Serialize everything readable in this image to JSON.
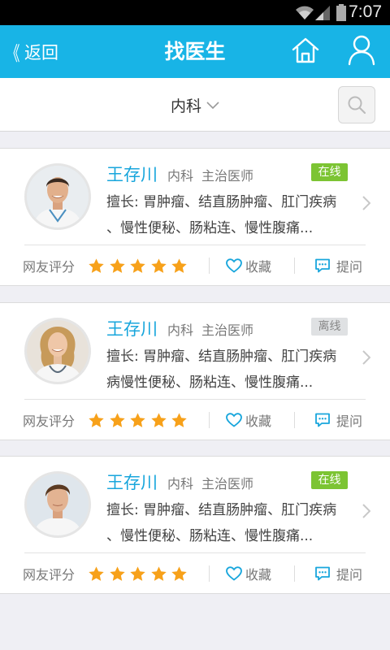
{
  "status_bar": {
    "time": "7:07"
  },
  "nav": {
    "back_label": "返回",
    "title": "找医生"
  },
  "filter": {
    "department": "内科"
  },
  "rating_label": "网友评分",
  "favorite_label": "收藏",
  "ask_label": "提问",
  "colors": {
    "accent": "#18b4e6",
    "online": "#7cc433",
    "offline": "#dfe1e3",
    "star": "#f7a11a",
    "icon_blue": "#18a6dc"
  },
  "doctors": [
    {
      "name": "王存川",
      "dept": "内科",
      "title": "主治医师",
      "status": "在线",
      "specialty_line1": "擅长: 胃肿瘤、结直肠肿瘤、肛门疾病",
      "specialty_line2": "、慢性便秘、肠粘连、慢性腹痛...",
      "rating": 5
    },
    {
      "name": "王存川",
      "dept": "内科",
      "title": "主治医师",
      "status": "离线",
      "specialty_line1": "擅长: 胃肿瘤、结直肠肿瘤、肛门疾病",
      "specialty_line2": "病慢性便秘、肠粘连、慢性腹痛...",
      "rating": 5
    },
    {
      "name": "王存川",
      "dept": "内科",
      "title": "主治医师",
      "status": "在线",
      "specialty_line1": "擅长: 胃肿瘤、结直肠肿瘤、肛门疾病",
      "specialty_line2": "、慢性便秘、肠粘连、慢性腹痛...",
      "rating": 5
    }
  ]
}
